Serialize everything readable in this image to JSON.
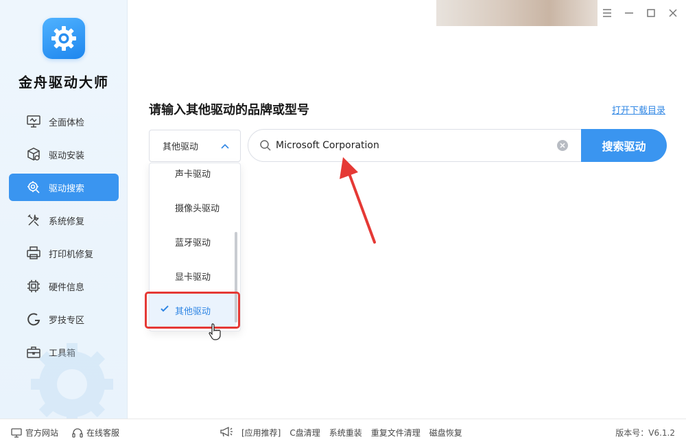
{
  "app": {
    "title": "金舟驱动大师"
  },
  "sidebar": {
    "items": [
      {
        "label": "全面体检",
        "icon": "monitor-check-icon",
        "active": false
      },
      {
        "label": "驱动安装",
        "icon": "package-gear-icon",
        "active": false
      },
      {
        "label": "驱动搜索",
        "icon": "gear-search-icon",
        "active": true
      },
      {
        "label": "系统修复",
        "icon": "wrench-tools-icon",
        "active": false
      },
      {
        "label": "打印机修复",
        "icon": "printer-icon",
        "active": false
      },
      {
        "label": "硬件信息",
        "icon": "chip-icon",
        "active": false
      },
      {
        "label": "罗技专区",
        "icon": "logitech-icon",
        "active": false
      },
      {
        "label": "工具箱",
        "icon": "toolbox-icon",
        "active": false
      }
    ]
  },
  "main": {
    "heading": "请输入其他驱动的品牌或型号",
    "catalog_link": "打开下载目录",
    "select": {
      "value": "其他驱动",
      "options": [
        "声卡驱动",
        "摄像头驱动",
        "蓝牙驱动",
        "显卡驱动",
        "其他驱动"
      ],
      "selected": "其他驱动"
    },
    "search": {
      "value": "Microsoft Corporation",
      "button": "搜索驱动"
    }
  },
  "footer": {
    "official_site": "官方网站",
    "online_service": "在线客服",
    "promo_label": "[应用推荐]",
    "promo_links": [
      "C盘清理",
      "系统重装",
      "重复文件清理",
      "磁盘恢复"
    ],
    "version": "版本号：V6.1.2"
  },
  "colors": {
    "accent": "#3a95f0",
    "highlight_box": "#e53935",
    "link": "#2f86e4"
  }
}
